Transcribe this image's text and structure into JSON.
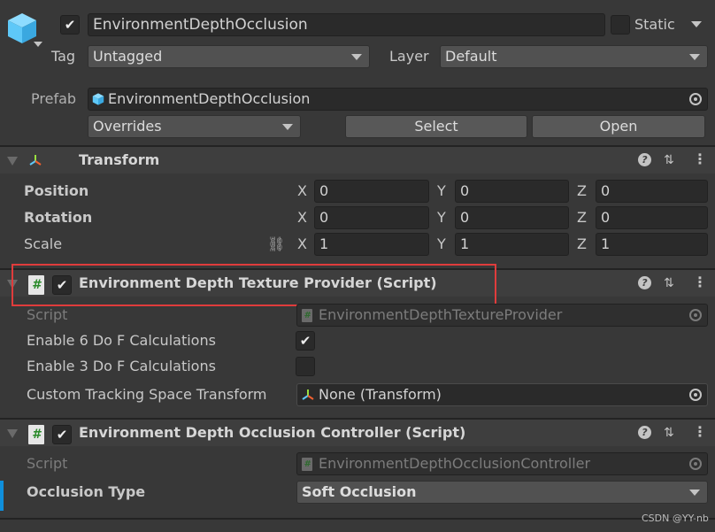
{
  "header": {
    "active": true,
    "name": "EnvironmentDepthOcclusion",
    "static_label": "Static",
    "static": false,
    "tag_label": "Tag",
    "tag_value": "Untagged",
    "layer_label": "Layer",
    "layer_value": "Default",
    "prefab_label": "Prefab",
    "prefab_value": "EnvironmentDepthOcclusion",
    "overrides": "Overrides",
    "select": "Select",
    "open": "Open"
  },
  "transform": {
    "title": "Transform",
    "rows": [
      {
        "label": "Position",
        "x": "0",
        "y": "0",
        "z": "0"
      },
      {
        "label": "Rotation",
        "x": "0",
        "y": "0",
        "z": "0"
      },
      {
        "label": "Scale",
        "x": "1",
        "y": "1",
        "z": "1"
      }
    ],
    "axes": {
      "x": "X",
      "y": "Y",
      "z": "Z"
    }
  },
  "provider": {
    "title": "Environment Depth Texture Provider (Script)",
    "enabled": true,
    "script_label": "Script",
    "script_value": "EnvironmentDepthTextureProvider",
    "enable6_label": "Enable 6 Do F Calculations",
    "enable6": true,
    "enable3_label": "Enable 3 Do F Calculations",
    "enable3": false,
    "tracking_label": "Custom Tracking Space Transform",
    "tracking_value": "None (Transform)"
  },
  "controller": {
    "title": "Environment Depth Occlusion Controller (Script)",
    "enabled": true,
    "script_label": "Script",
    "script_value": "EnvironmentDepthOcclusionController",
    "occlusion_label": "Occlusion Type",
    "occlusion_value": "Soft Occlusion"
  },
  "watermark": "CSDN @YY-nb",
  "colors": {
    "highlight": "#e03c3c",
    "modified_bar": "#0f8fdc",
    "cube": "#5ec8f8"
  }
}
